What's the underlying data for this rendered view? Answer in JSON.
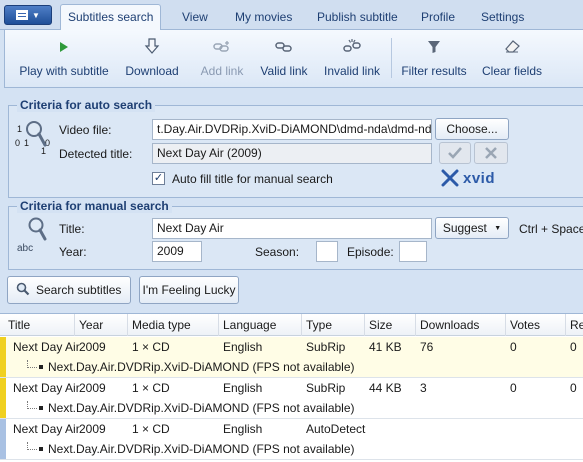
{
  "tabs": [
    "Subtitles search",
    "View",
    "My movies",
    "Publish subtitle",
    "Profile",
    "Settings"
  ],
  "ribbon": {
    "play": "Play with subtitle",
    "download": "Download",
    "add_link": "Add link",
    "valid_link": "Valid link",
    "invalid_link": "Invalid link",
    "filter": "Filter results",
    "clear": "Clear fields"
  },
  "auto": {
    "title": "Criteria for auto search",
    "video_label": "Video file:",
    "video_value": "t.Day.Air.DVDRip.XviD-DiAMOND\\dmd-nda\\dmd-nda.avi",
    "choose": "Choose...",
    "detected_label": "Detected title:",
    "detected_value": "Next Day Air (2009)",
    "autofill_label": "Auto fill title for manual search",
    "autofill_checked": true,
    "xvid_logo": "xvid",
    "icon_digits": [
      "1",
      "0",
      "1",
      "0",
      "1"
    ]
  },
  "manual": {
    "title": "Criteria for manual search",
    "title_label": "Title:",
    "title_value": "Next Day Air",
    "suggest": "Suggest",
    "shortcut": "Ctrl + Space",
    "year_label": "Year:",
    "year_value": "2009",
    "season_label": "Season:",
    "season_value": "",
    "episode_label": "Episode:",
    "episode_value": "",
    "icon_text": "abc"
  },
  "actions": {
    "search": "Search subtitles",
    "lucky": "I'm Feeling Lucky"
  },
  "table": {
    "columns": [
      "Title",
      "Year",
      "Media type",
      "Language",
      "Type",
      "Size",
      "Downloads",
      "Votes",
      "Re"
    ],
    "rows": [
      {
        "title": "Next Day Air",
        "year": "2009",
        "media": "1 × CD",
        "language": "English",
        "type": "SubRip",
        "size": "41 KB",
        "downloads": "76",
        "votes": "0",
        "rating": "0",
        "release": "Next.Day.Air.DVDRip.XviD-DiAMOND (FPS not available)",
        "marker": "#f0d020"
      },
      {
        "title": "Next Day Air",
        "year": "2009",
        "media": "1 × CD",
        "language": "English",
        "type": "SubRip",
        "size": "44 KB",
        "downloads": "3",
        "votes": "0",
        "rating": "0",
        "release": "Next.Day.Air.DVDRip.XviD-DiAMOND (FPS not available)",
        "marker": "#f0d020"
      },
      {
        "title": "Next Day Air",
        "year": "2009",
        "media": "1 × CD",
        "language": "English",
        "type": "AutoDetect",
        "size": "",
        "downloads": "",
        "votes": "",
        "rating": "",
        "release": "Next.Day.Air.DVDRip.XviD-DiAMOND (FPS not available)",
        "marker": "#a9c1e3"
      }
    ]
  }
}
